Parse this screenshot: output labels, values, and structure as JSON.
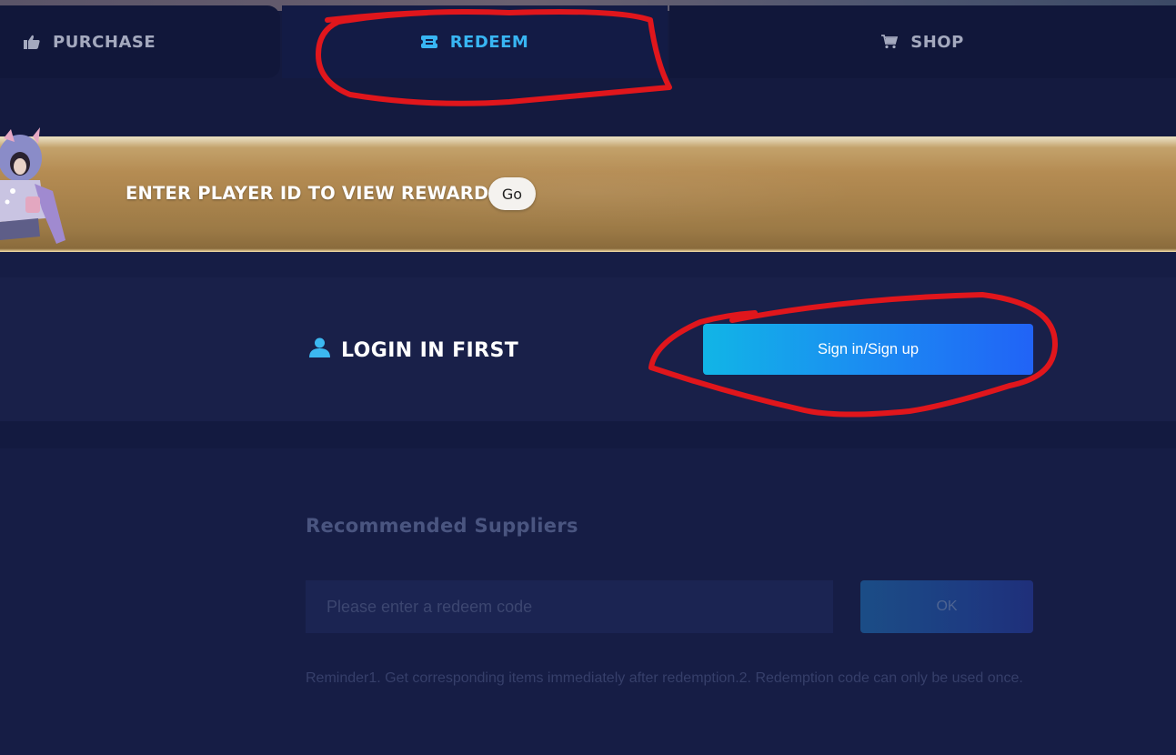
{
  "tabs": [
    {
      "label": "PURCHASE",
      "icon": "thumbs-up-icon",
      "active": false
    },
    {
      "label": "REDEEM",
      "icon": "ticket-icon",
      "active": true
    },
    {
      "label": "SHOP",
      "icon": "cart-icon",
      "active": false
    }
  ],
  "banner": {
    "text": "ENTER PLAYER ID TO VIEW REWARDS",
    "go_label": "Go"
  },
  "login": {
    "title": "LOGIN IN FIRST",
    "icon": "user-icon",
    "button_label": "Sign in/Sign up"
  },
  "redeem": {
    "title": "Recommended Suppliers",
    "placeholder": "Please enter a redeem code",
    "ok_label": "OK",
    "reminder": "Reminder1. Get corresponding items immediately after redemption.2. Redemption code can only be used once."
  },
  "colors": {
    "page_bg": "#161d45",
    "active_tab": "#38b5f2",
    "signin_gradient_start": "#11b5e6",
    "signin_gradient_end": "#2163f6",
    "annotation_red": "#e0161c"
  }
}
